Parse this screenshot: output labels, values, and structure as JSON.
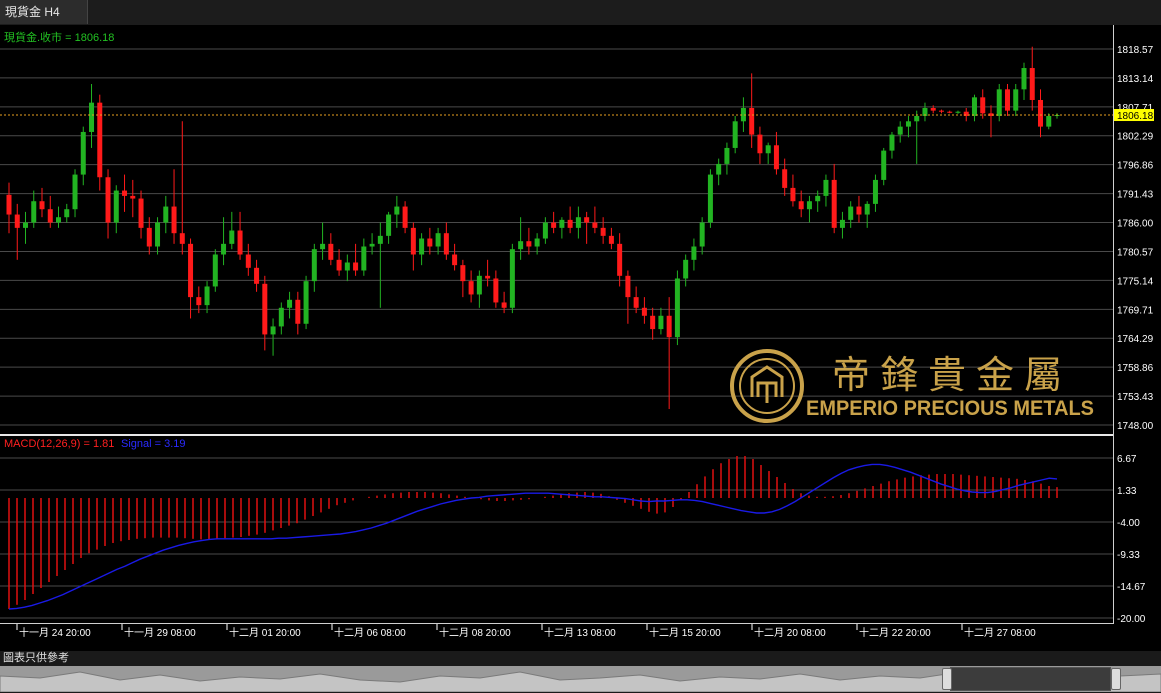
{
  "window": {
    "tab_title": "現貨金 H4"
  },
  "footer": {
    "note": "圖表只供參考"
  },
  "watermark": {
    "cn": "帝鋒貴金屬",
    "en": "EMPERIO PRECIOUS METALS"
  },
  "colors": {
    "up": "#22b422",
    "down": "#ff1a1a",
    "grid": "#4a4a4a",
    "axis_text": "#ffffff",
    "price_label_bg": "#ffff00",
    "signal": "#1a1ae6",
    "macd_bars": "#e01010",
    "legend_green": "#22c022",
    "gold": "#c9a24a"
  },
  "chart_data": [
    {
      "type": "candlestick",
      "symbol": "現貨金",
      "timeframe": "H4",
      "legend": "現貨金.收市 = 1806.18",
      "last_price_label": "1806.18",
      "last_price": 1806.18,
      "ylim": [
        1748.0,
        1818.57
      ],
      "y_ticks": [
        "1818.57",
        "1813.14",
        "1807.71",
        "1802.29",
        "1796.86",
        "1791.43",
        "1786.00",
        "1780.57",
        "1775.14",
        "1769.71",
        "1764.29",
        "1758.86",
        "1753.43",
        "1748.00"
      ],
      "x_ticks": [
        "十一月 24 20:00",
        "十一月 29 08:00",
        "十二月 01 20:00",
        "十二月 06 08:00",
        "十二月 08 20:00",
        "十二月 13 08:00",
        "十二月 15 20:00",
        "十二月 20 08:00",
        "十二月 22 20:00",
        "十二月 27 08:00"
      ],
      "grid": true,
      "candles": [
        [
          1791.2,
          1793.5,
          1784.0,
          1787.5
        ],
        [
          1787.5,
          1789.5,
          1779.0,
          1785.0
        ],
        [
          1785.0,
          1788.0,
          1782.0,
          1786.0
        ],
        [
          1786.0,
          1792.0,
          1785.0,
          1790.0
        ],
        [
          1790.0,
          1792.5,
          1787.0,
          1788.5
        ],
        [
          1788.5,
          1791.0,
          1785.0,
          1786.0
        ],
        [
          1786.0,
          1789.0,
          1785.0,
          1787.0
        ],
        [
          1787.0,
          1789.5,
          1786.0,
          1788.5
        ],
        [
          1788.5,
          1796.0,
          1787.0,
          1795.0
        ],
        [
          1795.0,
          1804.0,
          1793.0,
          1803.0
        ],
        [
          1803.0,
          1812.0,
          1800.0,
          1808.5
        ],
        [
          1808.5,
          1810.0,
          1792.0,
          1794.5
        ],
        [
          1794.5,
          1796.0,
          1783.0,
          1786.0
        ],
        [
          1786.0,
          1793.0,
          1784.0,
          1792.0
        ],
        [
          1792.0,
          1795.0,
          1788.0,
          1791.0
        ],
        [
          1791.0,
          1794.0,
          1787.0,
          1790.5
        ],
        [
          1790.5,
          1792.0,
          1783.0,
          1785.0
        ],
        [
          1785.0,
          1787.0,
          1780.0,
          1781.5
        ],
        [
          1781.5,
          1787.0,
          1780.0,
          1786.0
        ],
        [
          1786.0,
          1791.0,
          1784.0,
          1789.0
        ],
        [
          1789.0,
          1796.0,
          1782.0,
          1784.0
        ],
        [
          1784.0,
          1805.0,
          1780.0,
          1782.0
        ],
        [
          1782.0,
          1783.0,
          1768.0,
          1772.0
        ],
        [
          1772.0,
          1774.0,
          1769.0,
          1770.5
        ],
        [
          1770.5,
          1775.0,
          1769.0,
          1774.0
        ],
        [
          1774.0,
          1781.0,
          1773.0,
          1780.0
        ],
        [
          1780.0,
          1787.0,
          1778.0,
          1782.0
        ],
        [
          1782.0,
          1788.0,
          1781.0,
          1784.5
        ],
        [
          1784.5,
          1788.0,
          1779.0,
          1780.0
        ],
        [
          1780.0,
          1782.0,
          1776.0,
          1777.5
        ],
        [
          1777.5,
          1779.0,
          1773.0,
          1774.5
        ],
        [
          1774.5,
          1776.0,
          1762.0,
          1765.0
        ],
        [
          1765.0,
          1768.0,
          1761.0,
          1766.5
        ],
        [
          1766.5,
          1771.0,
          1765.0,
          1770.0
        ],
        [
          1770.0,
          1773.0,
          1768.0,
          1771.5
        ],
        [
          1771.5,
          1773.0,
          1765.0,
          1767.0
        ],
        [
          1767.0,
          1776.0,
          1766.0,
          1775.0
        ],
        [
          1775.0,
          1782.0,
          1773.0,
          1781.0
        ],
        [
          1781.0,
          1786.0,
          1779.0,
          1782.0
        ],
        [
          1782.0,
          1784.0,
          1778.0,
          1779.0
        ],
        [
          1779.0,
          1781.0,
          1776.0,
          1777.0
        ],
        [
          1777.0,
          1780.0,
          1775.0,
          1778.5
        ],
        [
          1778.5,
          1782.0,
          1776.0,
          1777.0
        ],
        [
          1777.0,
          1783.0,
          1776.0,
          1781.5
        ],
        [
          1781.5,
          1784.0,
          1780.0,
          1782.0
        ],
        [
          1782.0,
          1786.0,
          1770.0,
          1783.5
        ],
        [
          1783.5,
          1788.0,
          1782.0,
          1787.5
        ],
        [
          1787.5,
          1791.0,
          1785.0,
          1789.0
        ],
        [
          1789.0,
          1790.0,
          1784.0,
          1785.0
        ],
        [
          1785.0,
          1786.0,
          1777.0,
          1780.0
        ],
        [
          1780.0,
          1784.0,
          1778.0,
          1783.0
        ],
        [
          1783.0,
          1785.0,
          1780.0,
          1781.5
        ],
        [
          1781.5,
          1785.0,
          1780.0,
          1784.0
        ],
        [
          1784.0,
          1786.0,
          1779.0,
          1780.0
        ],
        [
          1780.0,
          1782.0,
          1777.0,
          1778.0
        ],
        [
          1778.0,
          1779.0,
          1772.0,
          1775.0
        ],
        [
          1775.0,
          1777.0,
          1771.0,
          1772.5
        ],
        [
          1772.5,
          1777.0,
          1770.0,
          1776.0
        ],
        [
          1776.0,
          1779.0,
          1774.0,
          1775.5
        ],
        [
          1775.5,
          1777.0,
          1770.0,
          1771.0
        ],
        [
          1771.0,
          1773.0,
          1769.0,
          1770.0
        ],
        [
          1770.0,
          1782.0,
          1769.0,
          1781.0
        ],
        [
          1781.0,
          1787.0,
          1779.0,
          1782.5
        ],
        [
          1782.5,
          1785.0,
          1780.0,
          1781.5
        ],
        [
          1781.5,
          1784.0,
          1780.0,
          1783.0
        ],
        [
          1783.0,
          1787.0,
          1782.0,
          1786.0
        ],
        [
          1786.0,
          1788.0,
          1784.0,
          1785.0
        ],
        [
          1785.0,
          1787.0,
          1783.0,
          1786.5
        ],
        [
          1786.5,
          1789.0,
          1784.0,
          1785.0
        ],
        [
          1785.0,
          1789.0,
          1783.0,
          1787.0
        ],
        [
          1787.0,
          1788.0,
          1782.0,
          1786.0
        ],
        [
          1786.0,
          1789.0,
          1784.0,
          1785.0
        ],
        [
          1785.0,
          1787.0,
          1782.0,
          1783.5
        ],
        [
          1783.5,
          1785.0,
          1781.0,
          1782.0
        ],
        [
          1782.0,
          1784.0,
          1774.0,
          1776.0
        ],
        [
          1776.0,
          1777.0,
          1767.0,
          1772.0
        ],
        [
          1772.0,
          1774.0,
          1769.0,
          1770.0
        ],
        [
          1770.0,
          1772.0,
          1767.0,
          1768.5
        ],
        [
          1768.5,
          1770.0,
          1764.0,
          1766.0
        ],
        [
          1766.0,
          1770.0,
          1765.0,
          1768.5
        ],
        [
          1768.5,
          1772.0,
          1751.0,
          1764.5
        ],
        [
          1764.5,
          1777.0,
          1763.0,
          1775.5
        ],
        [
          1775.5,
          1780.0,
          1774.0,
          1779.0
        ],
        [
          1779.0,
          1783.0,
          1777.0,
          1781.5
        ],
        [
          1781.5,
          1787.0,
          1780.0,
          1786.0
        ],
        [
          1786.0,
          1796.0,
          1785.0,
          1795.0
        ],
        [
          1795.0,
          1798.0,
          1793.0,
          1797.0
        ],
        [
          1797.0,
          1801.0,
          1795.0,
          1800.0
        ],
        [
          1800.0,
          1806.0,
          1799.0,
          1805.0
        ],
        [
          1805.0,
          1809.5,
          1803.0,
          1807.5
        ],
        [
          1807.5,
          1814.0,
          1800.0,
          1802.5
        ],
        [
          1802.5,
          1804.0,
          1797.0,
          1799.0
        ],
        [
          1799.0,
          1801.0,
          1797.0,
          1800.5
        ],
        [
          1800.5,
          1803.0,
          1795.0,
          1796.0
        ],
        [
          1796.0,
          1798.0,
          1791.0,
          1792.5
        ],
        [
          1792.5,
          1795.0,
          1789.0,
          1790.0
        ],
        [
          1790.0,
          1792.0,
          1787.0,
          1788.5
        ],
        [
          1788.5,
          1791.0,
          1786.0,
          1790.0
        ],
        [
          1790.0,
          1792.0,
          1788.0,
          1791.0
        ],
        [
          1791.0,
          1795.0,
          1789.0,
          1794.0
        ],
        [
          1794.0,
          1797.0,
          1784.0,
          1785.0
        ],
        [
          1785.0,
          1788.0,
          1783.0,
          1786.5
        ],
        [
          1786.5,
          1790.0,
          1785.0,
          1789.0
        ],
        [
          1789.0,
          1791.0,
          1786.0,
          1787.5
        ],
        [
          1787.5,
          1790.0,
          1785.0,
          1789.5
        ],
        [
          1789.5,
          1795.0,
          1788.0,
          1794.0
        ],
        [
          1794.0,
          1800.0,
          1793.0,
          1799.5
        ],
        [
          1799.5,
          1803.0,
          1798.0,
          1802.5
        ],
        [
          1802.5,
          1805.0,
          1801.0,
          1804.0
        ],
        [
          1804.0,
          1806.0,
          1802.0,
          1805.0
        ],
        [
          1805.0,
          1807.0,
          1797.0,
          1806.0
        ],
        [
          1806.0,
          1808.5,
          1805.0,
          1807.5
        ],
        [
          1807.5,
          1808.0,
          1806.5,
          1807.0
        ],
        [
          1807.0,
          1807.2,
          1806.5,
          1806.8
        ],
        [
          1806.8,
          1807.0,
          1806.5,
          1806.6
        ],
        [
          1806.6,
          1807.0,
          1806.4,
          1806.8
        ],
        [
          1806.8,
          1807.5,
          1805.0,
          1806.0
        ],
        [
          1806.0,
          1810.0,
          1805.0,
          1809.5
        ],
        [
          1809.5,
          1811.0,
          1805.5,
          1806.5
        ],
        [
          1806.5,
          1808.0,
          1802.0,
          1806.0
        ],
        [
          1806.0,
          1812.0,
          1805.0,
          1811.0
        ],
        [
          1811.0,
          1812.0,
          1806.0,
          1807.0
        ],
        [
          1807.0,
          1812.0,
          1806.0,
          1811.0
        ],
        [
          1811.0,
          1816.0,
          1809.0,
          1815.0
        ],
        [
          1815.0,
          1819.0,
          1807.0,
          1809.0
        ],
        [
          1809.0,
          1811.0,
          1802.0,
          1804.0
        ],
        [
          1804.0,
          1806.5,
          1803.5,
          1806.0
        ],
        [
          1806.0,
          1806.5,
          1805.5,
          1806.18
        ]
      ]
    },
    {
      "type": "bar+line",
      "indicator": "MACD(12,26,9)",
      "legend_macd": "MACD(12,26,9) = 1.81",
      "legend_signal": "Signal = 3.19",
      "ylim": [
        -20.0,
        6.67
      ],
      "y_ticks": [
        "6.67",
        "1.33",
        "-4.00",
        "-9.33",
        "-14.67",
        "-20.00"
      ],
      "macd": [
        -18.5,
        -17.8,
        -17.0,
        -16.0,
        -15.0,
        -14.0,
        -13.0,
        -12.0,
        -11.0,
        -10.0,
        -9.2,
        -8.6,
        -8.0,
        -7.5,
        -7.2,
        -7.0,
        -6.8,
        -6.7,
        -6.6,
        -6.6,
        -6.6,
        -6.6,
        -6.7,
        -6.8,
        -6.9,
        -6.9,
        -6.8,
        -6.7,
        -6.6,
        -6.5,
        -6.3,
        -6.1,
        -5.8,
        -5.4,
        -5.0,
        -4.6,
        -4.2,
        -3.6,
        -3.0,
        -2.4,
        -1.8,
        -1.2,
        -0.8,
        -0.4,
        0.0,
        0.2,
        0.4,
        0.6,
        0.8,
        0.9,
        1.0,
        1.0,
        1.0,
        0.9,
        0.8,
        0.6,
        0.4,
        0.2,
        0.0,
        -0.2,
        -0.4,
        -0.5,
        -0.5,
        -0.4,
        -0.3,
        -0.2,
        0.0,
        0.2,
        0.4,
        0.6,
        0.8,
        0.9,
        1.0,
        0.9,
        0.7,
        0.3,
        -0.3,
        -0.8,
        -1.3,
        -1.8,
        -2.3,
        -2.6,
        -2.4,
        -1.5,
        -0.3,
        1.0,
        2.3,
        3.6,
        4.8,
        5.8,
        6.5,
        7.0,
        7.0,
        6.5,
        5.5,
        4.5,
        3.5,
        2.5,
        1.5,
        0.8,
        0.4,
        0.2,
        0.2,
        0.3,
        0.5,
        0.8,
        1.2,
        1.6,
        2.0,
        2.4,
        2.8,
        3.1,
        3.4,
        3.6,
        3.8,
        3.9,
        4.0,
        4.0,
        4.0,
        3.9,
        3.8,
        3.7,
        3.6,
        3.5,
        3.4,
        3.3,
        3.2,
        3.0,
        2.8,
        2.4,
        2.0,
        1.81
      ],
      "signal": [
        -18.5,
        -18.4,
        -18.2,
        -17.9,
        -17.5,
        -17.1,
        -16.6,
        -16.1,
        -15.5,
        -14.9,
        -14.3,
        -13.7,
        -13.1,
        -12.5,
        -11.9,
        -11.4,
        -10.8,
        -10.2,
        -9.7,
        -9.2,
        -8.7,
        -8.3,
        -7.9,
        -7.6,
        -7.3,
        -7.1,
        -6.9,
        -6.8,
        -6.8,
        -6.8,
        -6.8,
        -6.8,
        -6.8,
        -6.8,
        -6.8,
        -6.7,
        -6.7,
        -6.6,
        -6.5,
        -6.4,
        -6.3,
        -6.2,
        -6.1,
        -6.0,
        -5.8,
        -5.6,
        -5.3,
        -5.0,
        -4.6,
        -4.2,
        -3.7,
        -3.2,
        -2.7,
        -2.2,
        -1.8,
        -1.4,
        -1.0,
        -0.7,
        -0.4,
        -0.2,
        0.0,
        0.1,
        0.3,
        0.4,
        0.5,
        0.6,
        0.7,
        0.8,
        0.8,
        0.8,
        0.8,
        0.7,
        0.6,
        0.5,
        0.4,
        0.3,
        0.2,
        0.2,
        0.1,
        0.0,
        -0.1,
        -0.3,
        -0.5,
        -0.6,
        -0.5,
        -0.5,
        -0.4,
        -0.3,
        -0.3,
        -0.4,
        -0.6,
        -0.9,
        -1.2,
        -1.5,
        -1.8,
        -2.1,
        -2.3,
        -2.5,
        -2.5,
        -2.3,
        -1.9,
        -1.3,
        -0.6,
        0.2,
        1.0,
        1.8,
        2.6,
        3.4,
        4.1,
        4.7,
        5.1,
        5.4,
        5.6,
        5.6,
        5.4,
        5.1,
        4.7,
        4.3,
        3.8,
        3.3,
        2.8,
        2.3,
        1.9,
        1.5,
        1.2,
        1.0,
        0.9,
        0.9,
        1.1,
        1.4,
        1.7,
        2.1,
        2.4,
        2.7,
        3.0,
        3.3,
        3.19
      ]
    }
  ]
}
